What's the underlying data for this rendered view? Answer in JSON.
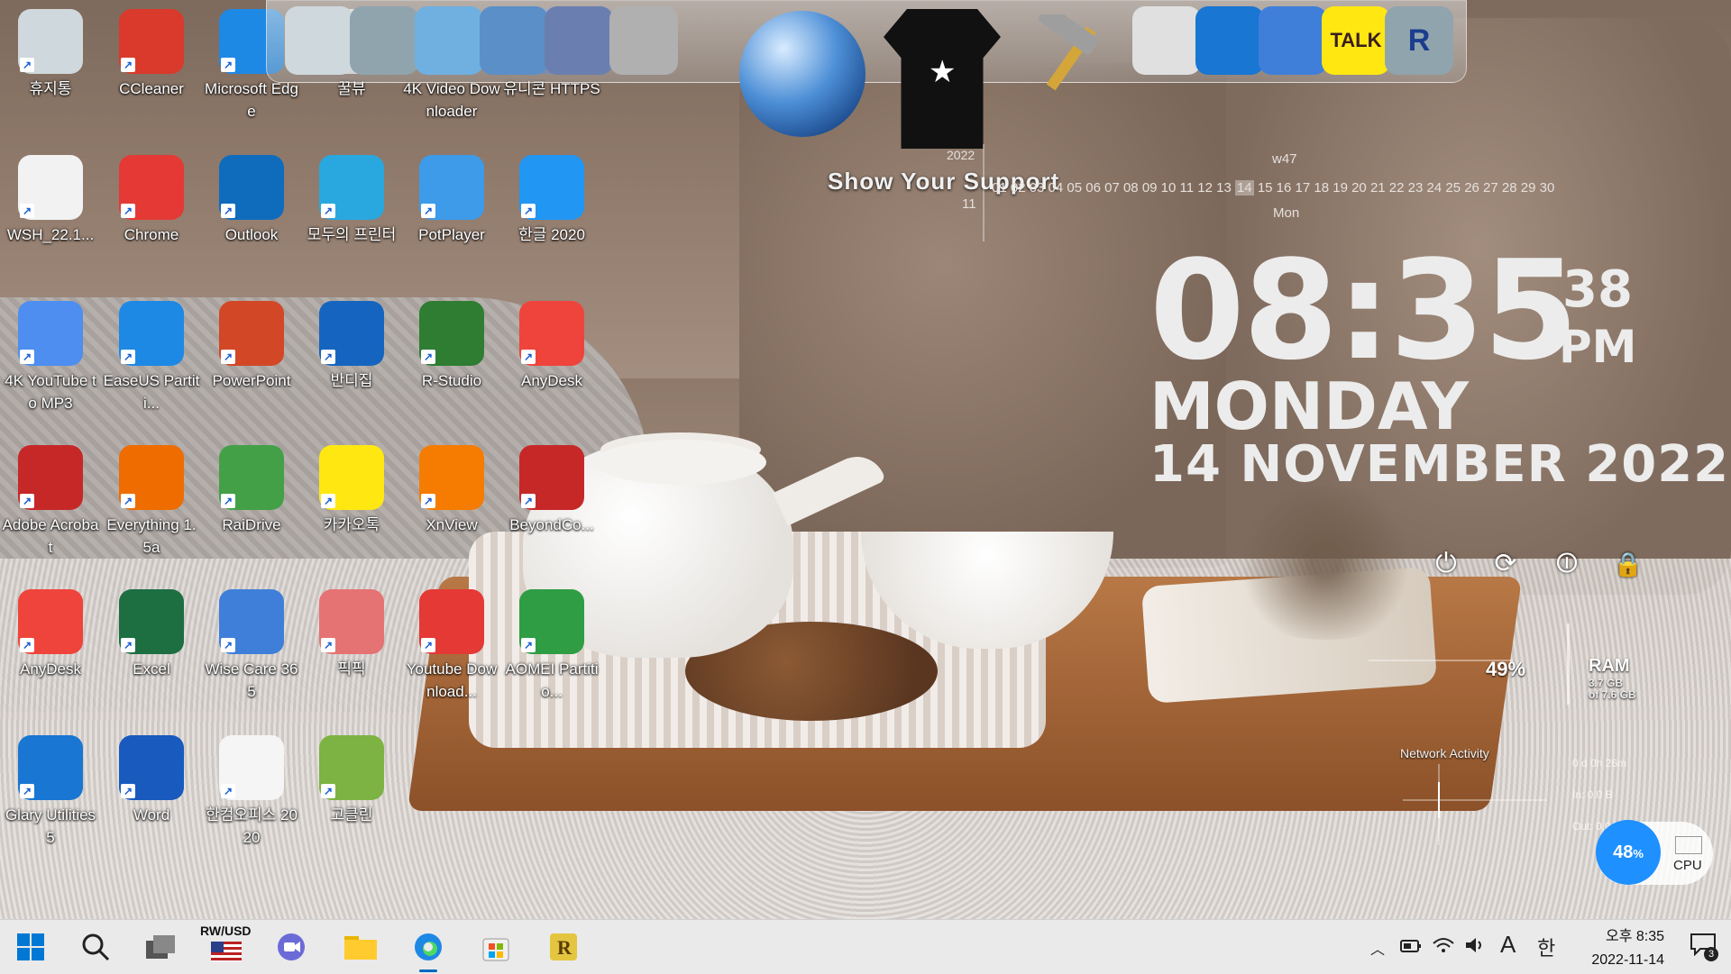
{
  "desktop": {
    "icons": [
      {
        "label": "휴지통",
        "icon": "recycle-bin-icon",
        "color": "#cfd8dc"
      },
      {
        "label": "CCleaner",
        "icon": "ccleaner-icon",
        "color": "#d93a2b"
      },
      {
        "label": "Microsoft Edge",
        "icon": "edge-icon",
        "color": "#1e88e5"
      },
      {
        "label": "꿀뷰",
        "icon": "honeyview-icon",
        "color": "#e0e0e0"
      },
      {
        "label": "4K Video Downloader",
        "icon": "folder-icon",
        "color": "#5aa9e6"
      },
      {
        "label": "유니콘 HTTPS",
        "icon": "folder-icon",
        "color": "#5a6ea6"
      },
      {
        "label": "WSH_22.1...",
        "icon": "file-icon",
        "color": "#f2f2f2"
      },
      {
        "label": "Chrome",
        "icon": "chrome-icon",
        "color": "#e53935"
      },
      {
        "label": "Outlook",
        "icon": "outlook-icon",
        "color": "#0f6cbd"
      },
      {
        "label": "모두의 프린터",
        "icon": "printer-icon",
        "color": "#29a8e0"
      },
      {
        "label": "PotPlayer",
        "icon": "potplayer-icon",
        "color": "#3d9be9"
      },
      {
        "label": "한글 2020",
        "icon": "hangul-icon",
        "color": "#2196f3"
      },
      {
        "label": "4K YouTube to MP3",
        "icon": "cloud-music-icon",
        "color": "#4d8ef0"
      },
      {
        "label": "EaseUS Partiti...",
        "icon": "easeus-icon",
        "color": "#1e88e5"
      },
      {
        "label": "PowerPoint",
        "icon": "powerpoint-icon",
        "color": "#d24726"
      },
      {
        "label": "반디집",
        "icon": "bandizip-icon",
        "color": "#1565c0"
      },
      {
        "label": "R-Studio",
        "icon": "r-studio-icon",
        "color": "#2e7d32"
      },
      {
        "label": "AnyDesk",
        "icon": "anydesk-icon",
        "color": "#ef443b"
      },
      {
        "label": "Adobe Acrobat",
        "icon": "acrobat-icon",
        "color": "#c62828"
      },
      {
        "label": "Everything 1.5a",
        "icon": "everything-icon",
        "color": "#ef6c00"
      },
      {
        "label": "RaiDrive",
        "icon": "raidrive-icon",
        "color": "#43a047"
      },
      {
        "label": "카카오톡",
        "icon": "kakaotalk-icon",
        "color": "#ffe812"
      },
      {
        "label": "XnView",
        "icon": "xnview-icon",
        "color": "#f57c00"
      },
      {
        "label": "BeyondCo...",
        "icon": "beyondcompare-icon",
        "color": "#c62828"
      },
      {
        "label": "AnyDesk",
        "icon": "anydesk-icon",
        "color": "#ef443b"
      },
      {
        "label": "Excel",
        "icon": "excel-icon",
        "color": "#1d6f42"
      },
      {
        "label": "Wise Care 365",
        "icon": "wise-care-icon",
        "color": "#3f7fd9"
      },
      {
        "label": "픽픽",
        "icon": "picpick-icon",
        "color": "#e57373"
      },
      {
        "label": "Youtube Download...",
        "icon": "youtube-downloader-icon",
        "color": "#e53935"
      },
      {
        "label": "AOMEI Partitio...",
        "icon": "aomei-icon",
        "color": "#2e9d44"
      },
      {
        "label": "Glary Utilities 5",
        "icon": "glary-icon",
        "color": "#1976d2"
      },
      {
        "label": "Word",
        "icon": "word-icon",
        "color": "#185abd"
      },
      {
        "label": "한컴오피스 2020",
        "icon": "hancom-office-icon",
        "color": "#f5f5f5"
      },
      {
        "label": "고클린",
        "icon": "goclean-icon",
        "color": "#7cb342"
      }
    ]
  },
  "dock": {
    "items": [
      {
        "icon": "monitor-icon",
        "color": "#cfd8dc"
      },
      {
        "icon": "network-globe-icon",
        "color": "#90a4ae"
      },
      {
        "icon": "folder-icon",
        "color": "#6fb0e0"
      },
      {
        "icon": "folder-icon",
        "color": "#5b8fc7"
      },
      {
        "icon": "folder-icon",
        "color": "#6a7fb0"
      },
      {
        "icon": "tools-icon",
        "color": "#b0b0b0"
      },
      {
        "icon": "recycle-bin-icon",
        "color": "#e0e0e0"
      },
      {
        "icon": "glary-icon",
        "color": "#1976d2"
      },
      {
        "icon": "wise-care-icon",
        "color": "#3f7fd9"
      },
      {
        "icon": "kakaotalk-icon",
        "color": "#ffe812",
        "text": "TALK"
      },
      {
        "icon": "r-studio-icon",
        "color": "#90a4ae",
        "text": "R"
      }
    ],
    "support_text": "Show Your Support"
  },
  "calendar": {
    "year": "2022",
    "month": "11",
    "week": "w47",
    "days_before": "01 02 03 04 05 06 07 08 09 10 11 12 13",
    "today": "14",
    "days_after": "15 16 17 18 19 20 21 22 23 24 25 26 27 28 29 30",
    "today_label": "Mon"
  },
  "clock": {
    "time": "08:35",
    "seconds": "38",
    "ampm": "PM",
    "day": "MONDAY",
    "date": "14 NOVEMBER  2022"
  },
  "power_buttons": [
    {
      "name": "shutdown",
      "glyph": "⏻"
    },
    {
      "name": "restart",
      "glyph": "⟳"
    },
    {
      "name": "logoff",
      "glyph": "⏼"
    },
    {
      "name": "lock",
      "glyph": "🔒"
    }
  ],
  "ram": {
    "percent": "49%",
    "label": "RAM",
    "used": "3.7 GB",
    "total": "of 7.6 GB",
    "fraction": 0.49
  },
  "network": {
    "label": "Network Activity",
    "uptime": "0 d 0h 26m",
    "in": "In: 0.0 B",
    "out": "Out: 0.0 B"
  },
  "cpu": {
    "percent": "48",
    "percent_sign": "%",
    "label": "CPU"
  },
  "taskbar": {
    "currency": "RW/USD",
    "clock_time": "오후 8:35",
    "clock_date": "2022-11-14",
    "ime": "A",
    "lang": "한",
    "notif_count": "3"
  },
  "colors": {
    "accent": "#0067c0",
    "taskbar_bg": "#eaeaea",
    "cpu_circle": "#1e90ff"
  }
}
